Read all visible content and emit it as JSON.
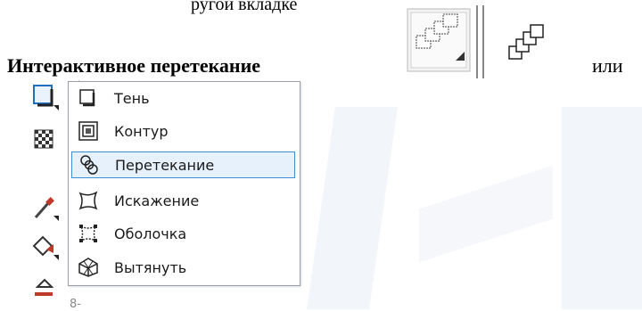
{
  "page": {
    "top_text": "ругой вкладке",
    "heading": "Интерактивное перетекание",
    "or": "или"
  },
  "toolbox": {
    "items": [
      {
        "icon": "shadow-tool-icon"
      },
      {
        "icon": "transparency-tool-icon"
      },
      {
        "icon": "eyedropper-tool-icon"
      },
      {
        "icon": "fill-tool-icon"
      },
      {
        "icon": "smart-fill-tool-icon"
      }
    ],
    "bottom_label": "8-"
  },
  "menu": {
    "items": [
      {
        "label": "Тень",
        "icon": "drop-shadow-icon",
        "selected": false
      },
      {
        "label": "Контур",
        "icon": "contour-icon",
        "selected": false
      },
      {
        "label": "Перетекание",
        "icon": "blend-icon",
        "selected": true
      },
      {
        "label": "Искажение",
        "icon": "distort-icon",
        "selected": false
      },
      {
        "label": "Оболочка",
        "icon": "envelope-icon",
        "selected": false
      },
      {
        "label": "Вытянуть",
        "icon": "extrude-icon",
        "selected": false
      }
    ]
  },
  "colors": {
    "selection_bg": "#e7f1fb",
    "selection_border": "#3b8fd6",
    "menu_border": "#9aa0a6"
  }
}
